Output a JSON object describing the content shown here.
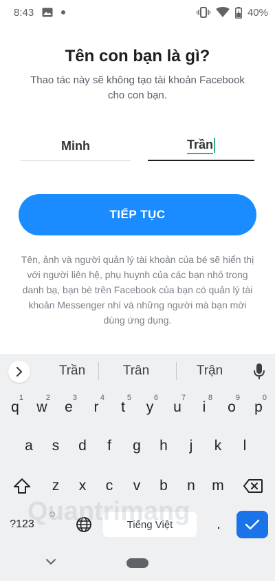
{
  "status_bar": {
    "time": "8:43",
    "battery": "40%"
  },
  "header": {
    "title": "Tên con bạn là gì?",
    "subtitle": "Thao tác này sẽ không tạo tài khoản Facebook cho con bạn."
  },
  "form": {
    "first_name": "Minh",
    "last_name": "Trần"
  },
  "continue_label": "TIẾP TỤC",
  "disclaimer": "Tên, ảnh và người quản lý tài khoản của bé sẽ hiển thị với người liên hệ, phụ huynh của các bạn nhỏ trong danh bạ, bạn bè trên Facebook của bạn có quản lý tài khoản Messenger nhí và những người mà bạn mời dùng ứng dụng.",
  "keyboard": {
    "suggestions": [
      "Trần",
      "Trân",
      "Trận"
    ],
    "row1": [
      {
        "key": "q",
        "hint": "1"
      },
      {
        "key": "w",
        "hint": "2"
      },
      {
        "key": "e",
        "hint": "3"
      },
      {
        "key": "r",
        "hint": "4"
      },
      {
        "key": "t",
        "hint": "5"
      },
      {
        "key": "y",
        "hint": "6"
      },
      {
        "key": "u",
        "hint": "7"
      },
      {
        "key": "i",
        "hint": "8"
      },
      {
        "key": "o",
        "hint": "9"
      },
      {
        "key": "p",
        "hint": "0"
      }
    ],
    "row2": [
      "a",
      "s",
      "d",
      "f",
      "g",
      "h",
      "j",
      "k",
      "l"
    ],
    "row3": [
      "z",
      "x",
      "c",
      "v",
      "b",
      "n",
      "m"
    ],
    "symbols_label": "?123",
    "emoji_hint": "☺",
    "space_label": "Tiếng Việt",
    "period_label": "."
  },
  "watermark": "Quantrimang",
  "colors": {
    "accent": "#1a8cff",
    "enter": "#1a73e8",
    "cursor": "#30b08d"
  }
}
